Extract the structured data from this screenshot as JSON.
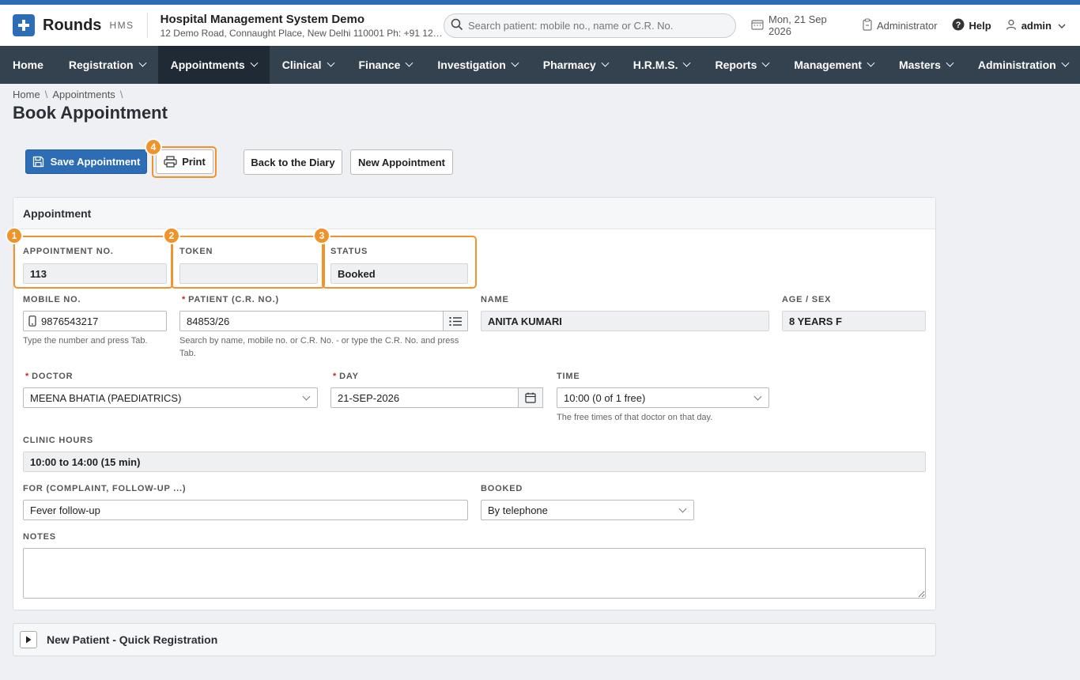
{
  "app": {
    "brand": "Rounds",
    "brand_sub": "HMS",
    "hospital_name": "Hospital Management System Demo",
    "hospital_address": "12 Demo Road, Connaught Place, New Delhi 110001 Ph: +91 123...",
    "search_placeholder": "Search patient: mobile no., name or C.R. No.",
    "date": "Mon, 21 Sep 2026",
    "role": "Administrator",
    "help": "Help",
    "user": "admin",
    "accent_color": "#2d6db5",
    "nav_color": "#34414f",
    "highlight_color": "#f0932a"
  },
  "nav": {
    "items": [
      {
        "label": "Home"
      },
      {
        "label": "Registration"
      },
      {
        "label": "Appointments"
      },
      {
        "label": "Clinical"
      },
      {
        "label": "Finance"
      },
      {
        "label": "Investigation"
      },
      {
        "label": "Pharmacy"
      },
      {
        "label": "H.R.M.S."
      },
      {
        "label": "Reports"
      },
      {
        "label": "Management"
      },
      {
        "label": "Masters"
      },
      {
        "label": "Administration"
      }
    ],
    "active": "Appointments"
  },
  "breadcrumb": [
    "Home",
    "Appointments"
  ],
  "page_title": "Book Appointment",
  "toolbar": {
    "save": "Save Appointment",
    "print": "Print",
    "back": "Back to the Diary",
    "new": "New Appointment"
  },
  "badges": [
    "1",
    "2",
    "3",
    "4"
  ],
  "panel": {
    "title": "Appointment",
    "appointment_no_label": "APPOINTMENT NO.",
    "appointment_no": "113",
    "token_label": "TOKEN",
    "token": "",
    "status_label": "STATUS",
    "status": "Booked",
    "mobile_label": "MOBILE NO.",
    "mobile": "9876543217",
    "mobile_help": "Type the number and press Tab.",
    "patient_label": "PATIENT (C.R. NO.)",
    "patient": "84853/26",
    "patient_help": "Search by name, mobile no. or C.R. No. - or type the C.R. No. and press Tab.",
    "name_label": "NAME",
    "name": "ANITA KUMARI",
    "age_label": "AGE / SEX",
    "age": "8 YEARS F",
    "doctor_label": "DOCTOR",
    "doctor": "MEENA BHATIA (PAEDIATRICS)",
    "day_label": "DAY",
    "day": "21-SEP-2026",
    "time_label": "TIME",
    "time": "10:00 (0 of 1 free)",
    "time_help": "The free times of that doctor on that day.",
    "clinic_label": "CLINIC HOURS",
    "clinic": "10:00 to 14:00 (15 min)",
    "for_label": "FOR (COMPLAINT, FOLLOW-UP ...)",
    "for": "Fever follow-up",
    "booked_label": "BOOKED",
    "booked": "By telephone",
    "notes_label": "NOTES",
    "notes": ""
  },
  "quick_reg": {
    "title": "New Patient - Quick Registration"
  }
}
